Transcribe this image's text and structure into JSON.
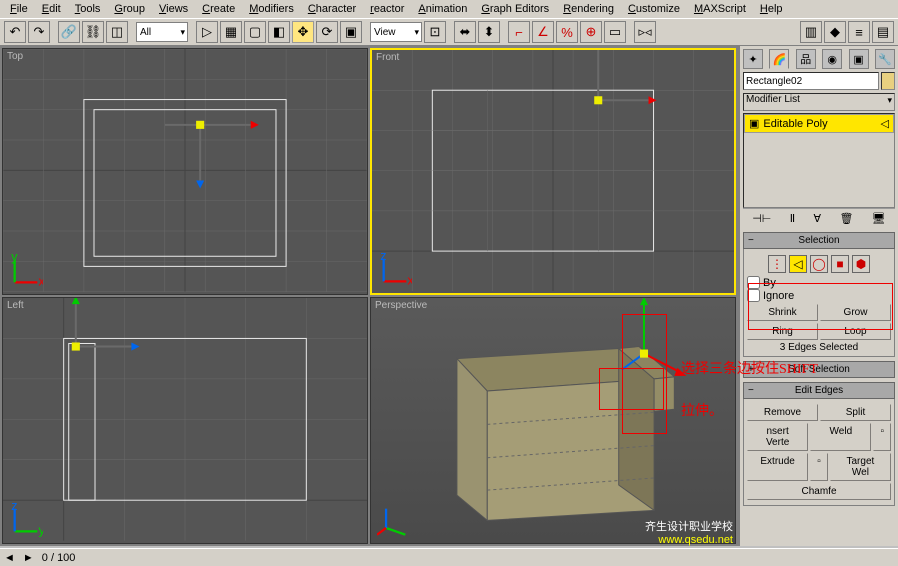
{
  "menu": [
    "File",
    "Edit",
    "Tools",
    "Group",
    "Views",
    "Create",
    "Modifiers",
    "Character",
    "reactor",
    "Animation",
    "Graph Editors",
    "Rendering",
    "Customize",
    "MAXScript",
    "Help"
  ],
  "toolbar": {
    "all_dropdown": "All",
    "view_dropdown": "View"
  },
  "viewports": {
    "top": "Top",
    "front": "Front",
    "left": "Left",
    "persp": "Perspective"
  },
  "side": {
    "objname": "Rectangle02",
    "modlist": "Modifier List",
    "stack_item": "Editable Poly",
    "sel_head": "Selection",
    "by": "By",
    "ignore": "Ignore",
    "shrink": "Shrink",
    "grow": "Grow",
    "ring": "Ring",
    "loop": "Loop",
    "status": "3 Edges Selected",
    "soft": "Soft Selection",
    "editedges": "Edit Edges",
    "remove": "Remove",
    "split": "Split",
    "insvert": "nsert Verte",
    "weld": "Weld",
    "extrude": "Extrude",
    "targetw": "Target Wel",
    "chamfer": "Chamfe"
  },
  "bottom": {
    "frame": "0 / 100"
  },
  "annot": {
    "line1": "选择三条边按住SHIFT",
    "line2": "拉伸。"
  },
  "watermark": {
    "l1": "齐生设计职业学校",
    "l2": "www.qsedu.net"
  }
}
